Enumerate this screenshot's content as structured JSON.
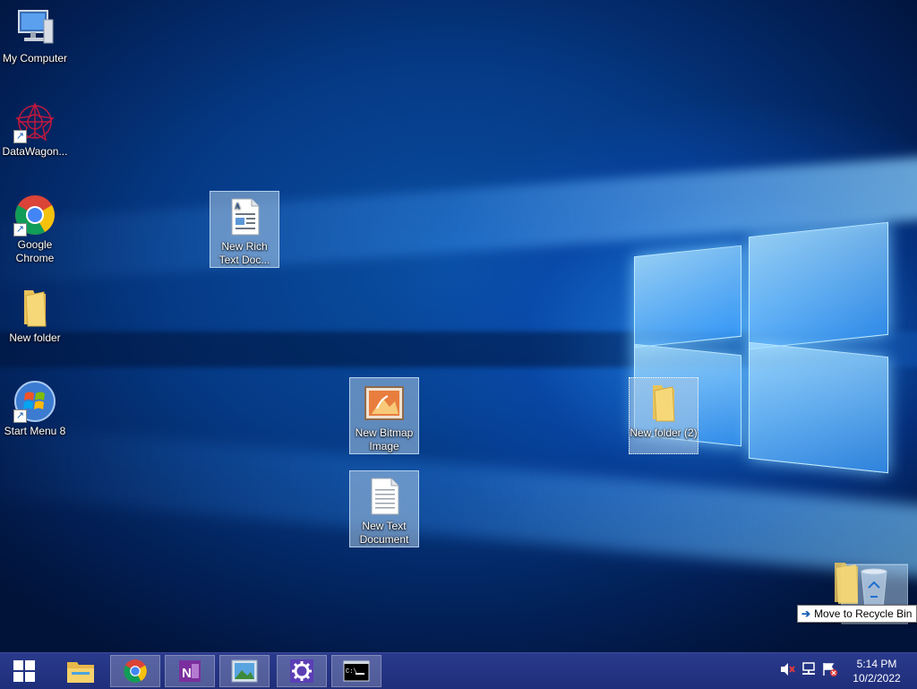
{
  "desktop": {
    "icons": [
      {
        "label": "My Computer"
      },
      {
        "label": "DataWagon..."
      },
      {
        "label": "Google Chrome"
      },
      {
        "label": "New folder"
      },
      {
        "label": "Start Menu 8"
      },
      {
        "label": "New Rich Text Doc..."
      },
      {
        "label": "New Bitmap Image"
      },
      {
        "label": "New Text Document"
      },
      {
        "label": "New folder (2)"
      }
    ]
  },
  "drag": {
    "tooltip": "Move to Recycle Bin"
  },
  "taskbar": {
    "apps": [
      "File Explorer",
      "Google Chrome",
      "OneNote",
      "Photos",
      "Settings",
      "Command Prompt"
    ],
    "accent": "#2a3a8c"
  },
  "tray": {
    "time": "5:14 PM",
    "date": "10/2/2022"
  }
}
